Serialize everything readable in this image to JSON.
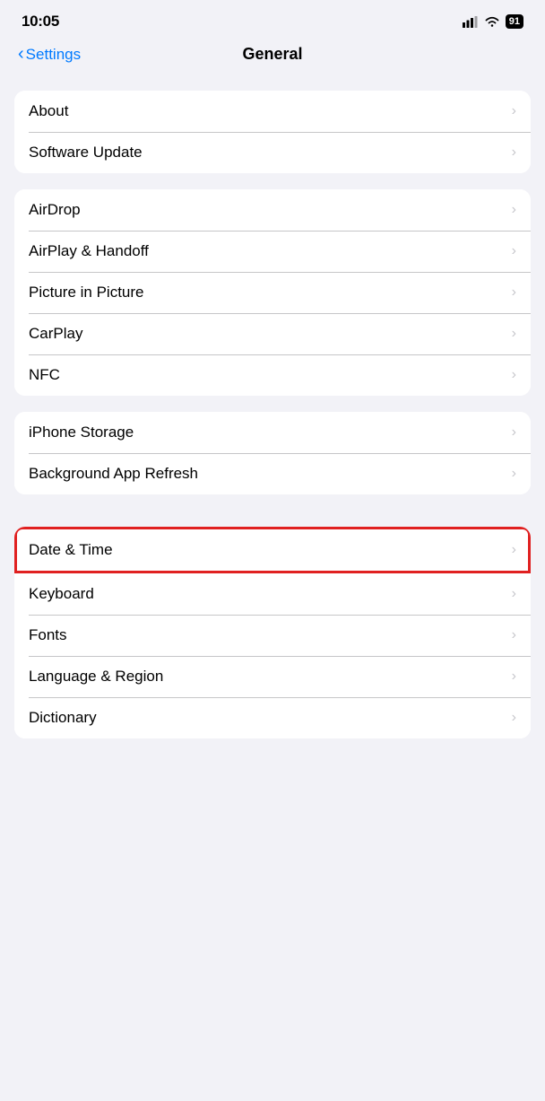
{
  "statusBar": {
    "time": "10:05",
    "battery": "91"
  },
  "navBar": {
    "backLabel": "Settings",
    "title": "General"
  },
  "groups": [
    {
      "id": "group1",
      "items": [
        {
          "label": "About"
        },
        {
          "label": "Software Update"
        }
      ]
    },
    {
      "id": "group2",
      "items": [
        {
          "label": "AirDrop"
        },
        {
          "label": "AirPlay & Handoff"
        },
        {
          "label": "Picture in Picture"
        },
        {
          "label": "CarPlay"
        },
        {
          "label": "NFC"
        }
      ]
    },
    {
      "id": "group3",
      "items": [
        {
          "label": "iPhone Storage"
        },
        {
          "label": "Background App Refresh"
        }
      ]
    }
  ],
  "highlightedItem": {
    "label": "Date & Time",
    "highlighted": true
  },
  "group4Rest": {
    "items": [
      {
        "label": "Keyboard"
      },
      {
        "label": "Fonts"
      },
      {
        "label": "Language & Region"
      },
      {
        "label": "Dictionary"
      }
    ]
  },
  "chevron": "›"
}
